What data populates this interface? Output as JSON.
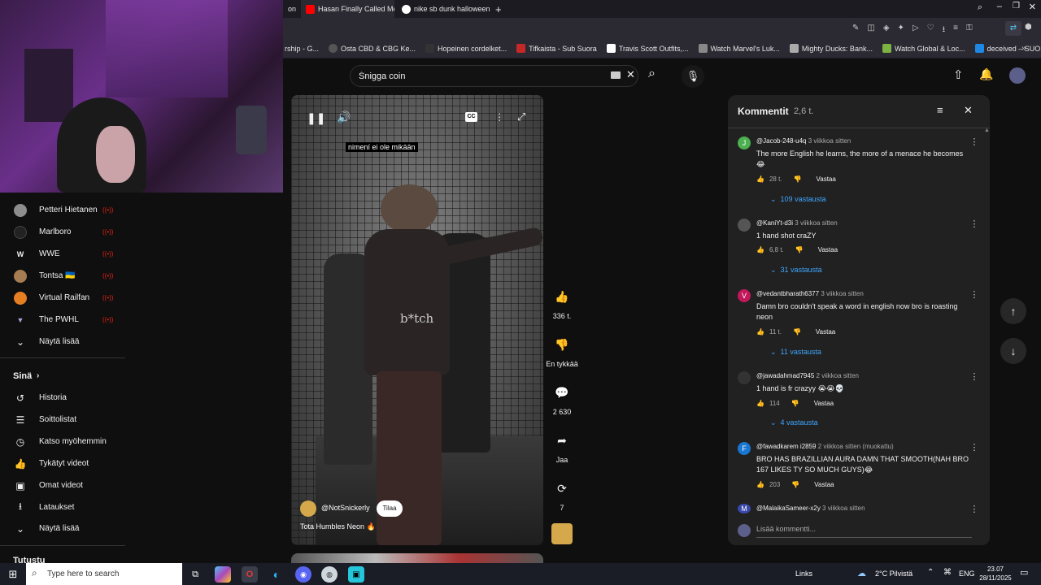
{
  "browser": {
    "tabs": [
      {
        "label": "on"
      },
      {
        "label": "Hasan Finally Called Me O"
      },
      {
        "label": "nike sb dunk halloween -"
      }
    ],
    "bookmarks": [
      "rship - G...",
      "Osta CBD & CBG Ke...",
      "Hopeinen cordelket...",
      "Tifkaista - Sub Suora",
      "Travis Scott Outfits,...",
      "Watch Marvel's Luk...",
      "Mighty Ducks: Bank...",
      "Watch Global & Loc...",
      "deceived – SUORAT..."
    ]
  },
  "youtube": {
    "search_value": "Śnigga coin",
    "sidebar": {
      "subscriptions": [
        {
          "label": "Petteri Hietanen"
        },
        {
          "label": "Marlboro"
        },
        {
          "label": "WWE"
        },
        {
          "label": "Tontsa 🇺🇦"
        },
        {
          "label": "Virtual Railfan"
        },
        {
          "label": "The PWHL"
        }
      ],
      "show_more_1": "Näytä lisää",
      "you_header": "Sinä",
      "you_items": [
        {
          "label": "Historia",
          "icon": "history-icon"
        },
        {
          "label": "Soittolistat",
          "icon": "playlists-icon"
        },
        {
          "label": "Katso myöhemmin",
          "icon": "watch-later-icon"
        },
        {
          "label": "Tykätyt videot",
          "icon": "liked-icon"
        },
        {
          "label": "Omat videot",
          "icon": "your-videos-icon"
        },
        {
          "label": "Lataukset",
          "icon": "downloads-icon"
        }
      ],
      "show_more_2": "Näytä lisää",
      "explore_header": "Tutustu"
    },
    "short": {
      "caption": "nimení ei ole mikään",
      "overlay_text": "b*tch",
      "channel": "@NotSnickerly",
      "subscribe_label": "Tilaa",
      "title": "Tota Humbles Neon 🔥"
    },
    "actions": {
      "likes": "336 t.",
      "dislike_label": "En tykkää",
      "comments": "2 630",
      "share_label": "Jaa",
      "remix": "7"
    },
    "comments_panel": {
      "title": "Kommentit",
      "count": "2,6 t.",
      "add_placeholder": "Lisää kommentti...",
      "reply_label": "Vastaa",
      "comments": [
        {
          "author": "@Jacob-248-u4q",
          "time": "3 viikkoa sitten",
          "text": "The more English he learns, the more of a menace he becomes 😂",
          "likes": "28 t.",
          "replies": "109 vastausta",
          "avatar_letter": "J",
          "avatar_color": "#4caf50"
        },
        {
          "author": "@KaniYt-d3i",
          "time": "3 viikkoa sitten",
          "text": "1 hand shot craZY",
          "likes": "6,8 t.",
          "replies": "31 vastausta",
          "avatar_letter": "",
          "avatar_color": "#555555"
        },
        {
          "author": "@vedantbharath6377",
          "time": "3 viikkoa sitten",
          "text": "Damn bro couldn't speak a word in english now bro is roasting neon",
          "likes": "11 t.",
          "replies": "11 vastausta",
          "avatar_letter": "V",
          "avatar_color": "#c2185b"
        },
        {
          "author": "@jawadahmad7945",
          "time": "2 viikkoa sitten",
          "text": "1 hand is fr crazyy 😭😭💀",
          "likes": "114",
          "replies": "4 vastausta",
          "avatar_letter": "",
          "avatar_color": "#333333"
        },
        {
          "author": "@fawadkarem i2859",
          "time": "2 viikkoa sitten (muokattu)",
          "text": "BRO HAS BRAZILLIAN AURA DAMN THAT SMOOTH(NAH BRO 167 LIKES TY SO MUCH GUYS)😂",
          "likes": "203",
          "replies": "",
          "avatar_letter": "F",
          "avatar_color": "#1976d2"
        },
        {
          "author": "@MalaikaSameer-x2y",
          "time": "3 viikkoa sitten",
          "text": "",
          "likes": "",
          "replies": "",
          "avatar_letter": "M",
          "avatar_color": "#3949ab"
        }
      ]
    }
  },
  "taskbar": {
    "search_placeholder": "Type here to search",
    "links_label": "Links",
    "weather": "2°C Pilvistä",
    "lang": "ENG",
    "time": "23.07",
    "date": "28/11/2025"
  }
}
